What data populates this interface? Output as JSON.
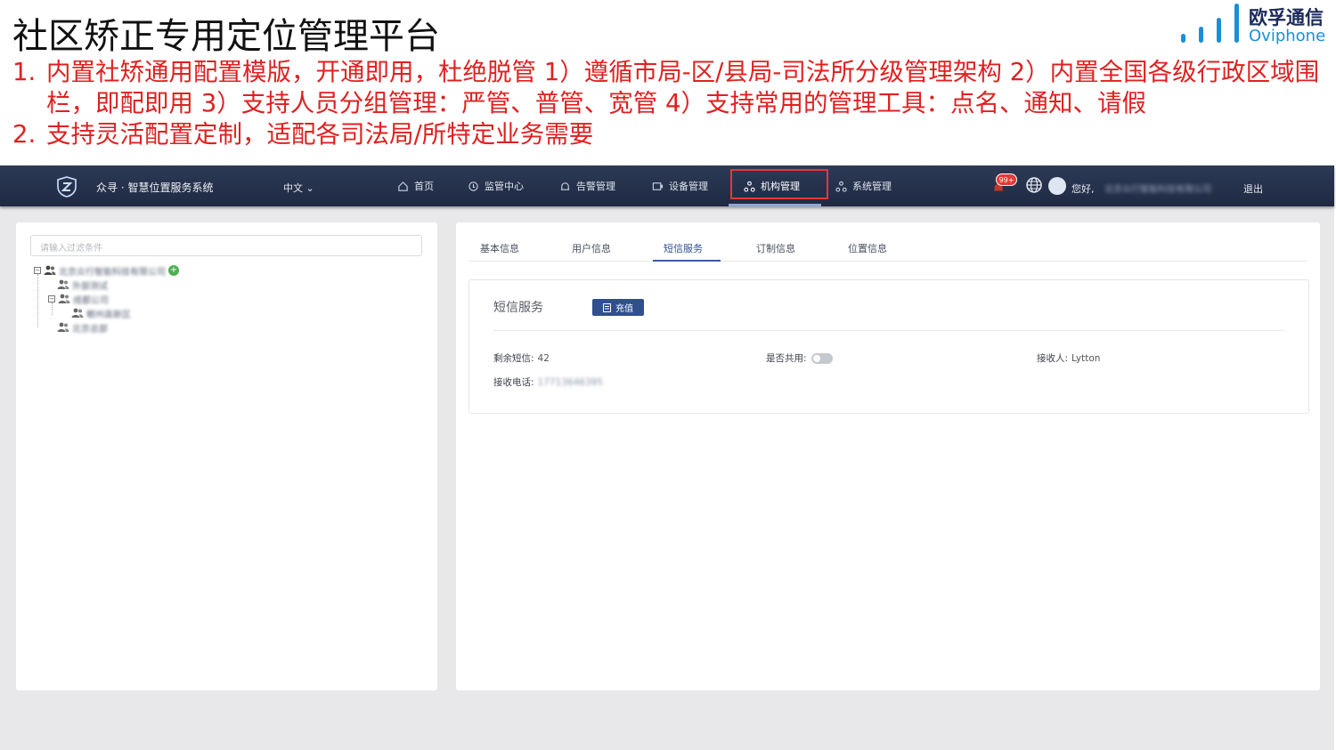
{
  "slide": {
    "title": "社区矫正专用定位管理平台",
    "brand_cn": "欧孚通信",
    "brand_en": "Oviphone",
    "points": [
      {
        "num": "1.",
        "text": "内置社矫通用配置模版，开通即用，杜绝脱管 1）遵循市局-区/县局-司法所分级管理架构 2）内置全国各级行政区域围栏，即配即用 3）支持人员分组管理：严管、普管、宽管 4）支持常用的管理工具：点名、通知、请假"
      },
      {
        "num": "2.",
        "text": "支持灵活配置定制，适配各司法局/所特定业务需要"
      }
    ]
  },
  "nav": {
    "system_name": "众寻 · 智慧位置服务系统",
    "language": "中文",
    "menu": [
      {
        "label": "首页",
        "icon": "home-icon"
      },
      {
        "label": "监管中心",
        "icon": "monitor-icon"
      },
      {
        "label": "告警管理",
        "icon": "alarm-icon"
      },
      {
        "label": "设备管理",
        "icon": "device-icon"
      },
      {
        "label": "机构管理",
        "icon": "org-icon"
      },
      {
        "label": "系统管理",
        "icon": "system-icon"
      }
    ],
    "badge": "99+",
    "greeting": "您好,",
    "company": "北京众行智能科技有限公司",
    "logout": "退出"
  },
  "left": {
    "filter_placeholder": "请输入过滤条件",
    "tree": [
      {
        "label": "北京众行智能科技有限公司"
      },
      {
        "label": "外部测试"
      },
      {
        "label": "成都公司"
      },
      {
        "label": "郫州高新区"
      },
      {
        "label": "北京总部"
      }
    ]
  },
  "right": {
    "tabs": [
      "基本信息",
      "用户信息",
      "短信服务",
      "订制信息",
      "位置信息"
    ],
    "active_tab": "短信服务",
    "card_title": "短信服务",
    "recharge_label": "充值",
    "fields": {
      "remaining_label": "剩余短信:",
      "remaining_value": "42",
      "shared_label": "是否共用:",
      "receiver_label": "接收人:",
      "receiver_value": "Lytton",
      "phone_label": "接收电话:",
      "phone_value": "17713646395"
    }
  },
  "colors": {
    "accent_red": "#e02020",
    "nav_bg": "#26324c",
    "brand_blue": "#1a8fd6",
    "primary_button": "#2f4f8f"
  }
}
